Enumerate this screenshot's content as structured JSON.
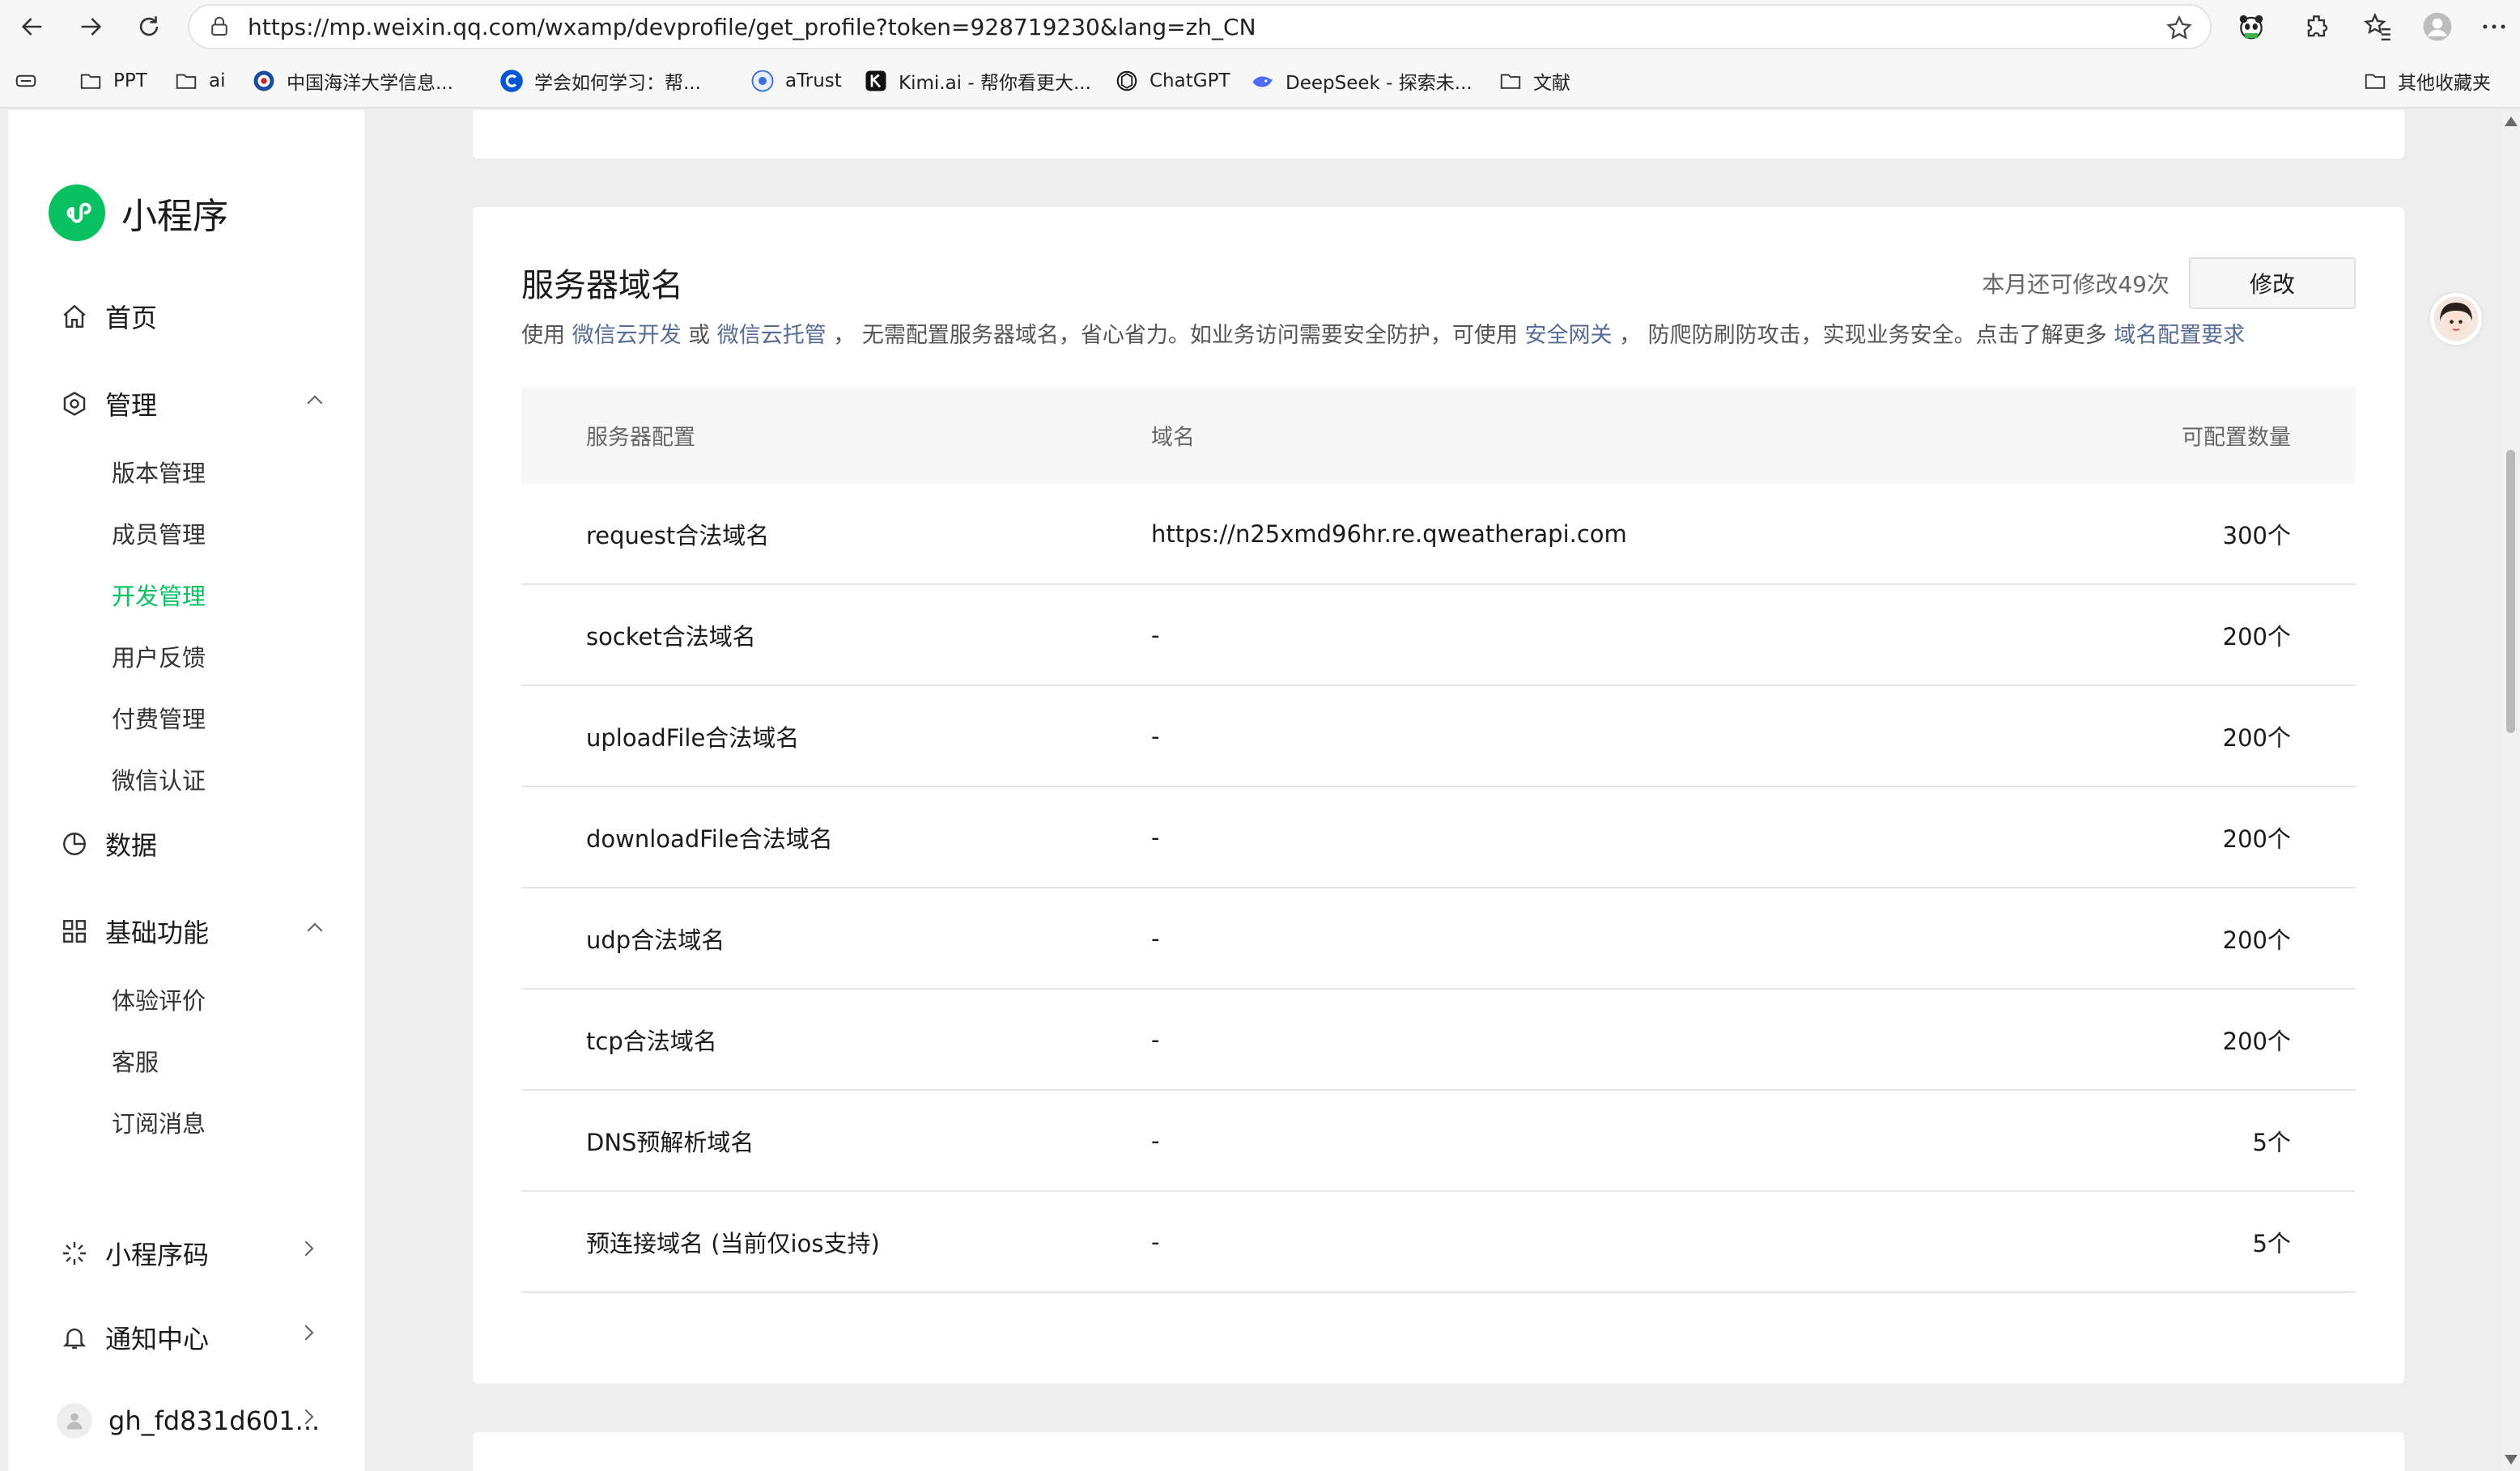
{
  "browser": {
    "url": "https://mp.weixin.qq.com/wxamp/devprofile/get_profile?token=928719230&lang=zh_CN",
    "bookmarks": [
      {
        "label": "PPT",
        "icon": "folder-icon"
      },
      {
        "label": "ai",
        "icon": "folder-icon"
      },
      {
        "label": "中国海洋大学信息...",
        "icon": "university-icon"
      },
      {
        "label": "学会如何学习：帮...",
        "icon": "coursera-icon"
      },
      {
        "label": "aTrust",
        "icon": "atrust-icon"
      },
      {
        "label": "Kimi.ai - 帮你看更大...",
        "icon": "kimi-icon"
      },
      {
        "label": "ChatGPT",
        "icon": "chatgpt-icon"
      },
      {
        "label": "DeepSeek - 探索未...",
        "icon": "deepseek-icon"
      },
      {
        "label": "文献",
        "icon": "folder-icon"
      }
    ],
    "other_bookmarks": "其他收藏夹"
  },
  "sidebar": {
    "app_name": "小程序",
    "home": "首页",
    "manage": "管理",
    "manage_items": [
      "版本管理",
      "成员管理",
      "开发管理",
      "用户反馈",
      "付费管理",
      "微信认证"
    ],
    "active_item": "开发管理",
    "data": "数据",
    "basic": "基础功能",
    "basic_items": [
      "体验评价",
      "客服",
      "订阅消息"
    ],
    "qrcode": "小程序码",
    "notify": "通知中心",
    "account": "gh_fd831d601..."
  },
  "server_domain": {
    "title": "服务器域名",
    "quota_text": "本月还可修改49次",
    "modify_button": "修改",
    "desc_1": "使用 ",
    "link_1": "微信云开发",
    "desc_2": " 或 ",
    "link_2": "微信云托管",
    "desc_3": " ， 无需配置服务器域名，省心省力。如业务访问需要安全防护，可使用 ",
    "link_3": "安全网关",
    "desc_4": " ， 防爬防刷防攻击，实现业务安全。点击了解更多 ",
    "link_4": "域名配置要求",
    "columns": [
      "服务器配置",
      "域名",
      "可配置数量"
    ],
    "rows": [
      {
        "config": "request合法域名",
        "domain": "https://n25xmd96hr.re.qweatherapi.com",
        "count": "300个"
      },
      {
        "config": "socket合法域名",
        "domain": "-",
        "count": "200个"
      },
      {
        "config": "uploadFile合法域名",
        "domain": "-",
        "count": "200个"
      },
      {
        "config": "downloadFile合法域名",
        "domain": "-",
        "count": "200个"
      },
      {
        "config": "udp合法域名",
        "domain": "-",
        "count": "200个"
      },
      {
        "config": "tcp合法域名",
        "domain": "-",
        "count": "200个"
      },
      {
        "config": "DNS预解析域名",
        "domain": "-",
        "count": "5个"
      },
      {
        "config": "预连接域名 (当前仅ios支持)",
        "domain": "-",
        "count": "5个"
      }
    ]
  },
  "colors": {
    "brand_green": "#07c160",
    "link_blue": "#576b95",
    "page_bg": "#ededed"
  }
}
